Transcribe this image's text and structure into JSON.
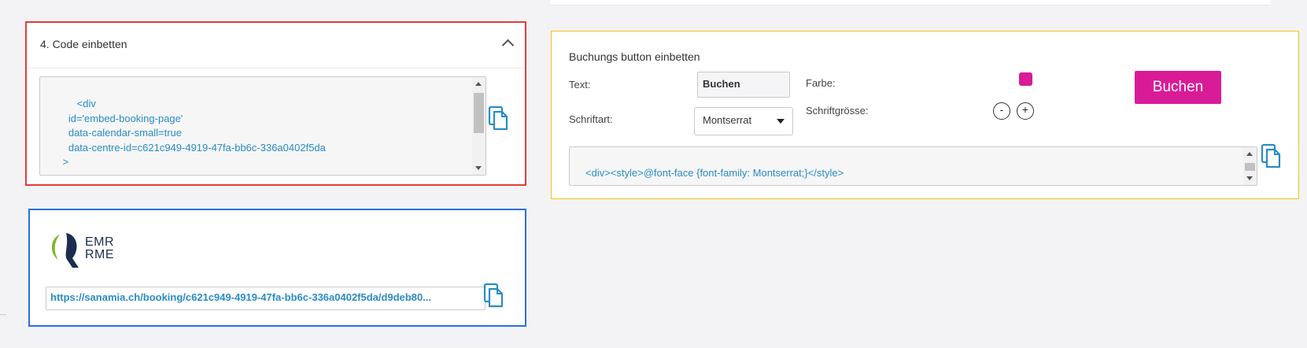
{
  "code_panel": {
    "title": "4. Code einbetten",
    "code_lines": [
      "      <div",
      "   id='embed-booking-page'",
      "   data-calendar-small=true",
      "   data-centre-id=c621c949-4919-47fa-bb6c-336a0402f5da",
      " >",
      "  ."
    ]
  },
  "link_panel": {
    "logo_text": [
      "EMR",
      "RME"
    ],
    "url": "https://sanamia.ch/booking/c621c949-4919-47fa-bb6c-336a0402f5da/d9deb80..."
  },
  "button_panel": {
    "title": "Buchungs button einbetten",
    "text_label": "Text:",
    "text_value": "Buchen",
    "font_label": "Schriftart:",
    "font_value": "Montserrat",
    "color_label": "Farbe:",
    "color_value": "#d91b98",
    "size_label": "Schriftgrösse:",
    "minus": "-",
    "plus": "+",
    "preview_label": "Buchen",
    "code_line": "<div><style>@font-face {font-family: Montserrat;}</style>"
  },
  "colors": {
    "code_panel_border": "#e53b3b",
    "link_panel_border": "#2b6fe0",
    "button_panel_border": "#f0c419",
    "accent_blue": "#2a8cc4",
    "button_color": "#d91b98"
  },
  "icons": [
    "chevron-up-icon",
    "copy-icon",
    "logo-icon",
    "caret-down-icon"
  ]
}
